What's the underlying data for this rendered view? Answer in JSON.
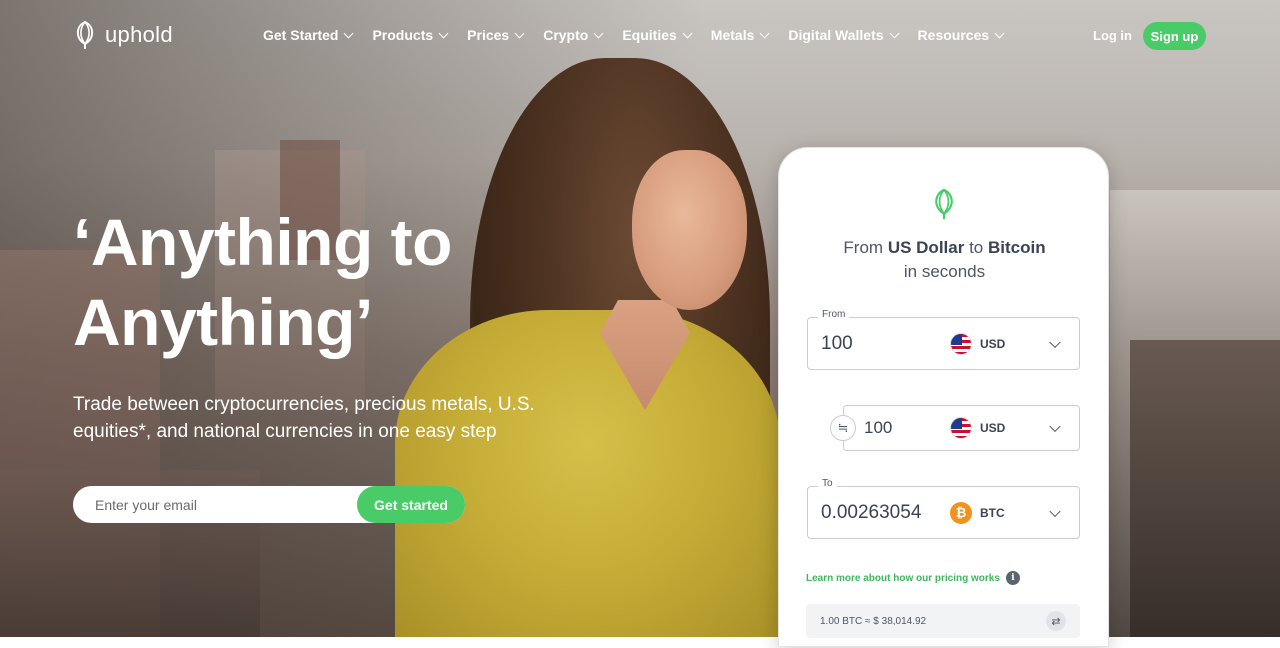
{
  "brand": {
    "name": "uphold",
    "logo_icon": "uphold-logo-icon",
    "accent_color": "#49cc68"
  },
  "nav": {
    "items": [
      {
        "label": "Get Started"
      },
      {
        "label": "Products"
      },
      {
        "label": "Prices"
      },
      {
        "label": "Crypto"
      },
      {
        "label": "Equities"
      },
      {
        "label": "Metals"
      },
      {
        "label": "Digital Wallets"
      },
      {
        "label": "Resources"
      }
    ],
    "login_label": "Log in",
    "signup_label": "Sign up"
  },
  "hero": {
    "headline_line1": "‘Anything to",
    "headline_line2": "Anything’",
    "subtitle": "Trade between cryptocurrencies, precious metals, U.S. equities*, and national currencies in one easy step",
    "email_placeholder": "Enter your email",
    "cta_label": "Get started"
  },
  "widget": {
    "title_prefix": "From ",
    "title_from": "US Dollar",
    "title_mid": " to ",
    "title_to": "Bitcoin",
    "title_suffix": "in seconds",
    "from_label": "From",
    "from_value": "100",
    "from_currency": "USD",
    "mid_value": "100",
    "mid_currency": "USD",
    "swap_icon": "≒",
    "to_label": "To",
    "to_value": "0.00263054",
    "to_currency": "BTC",
    "btc_symbol": "₿",
    "learn_more": "Learn more about how our pricing works",
    "info_symbol": "i",
    "rate_text": "1.00 BTC ≈ $ 38,014.92",
    "rate_swap_icon": "⇄"
  }
}
